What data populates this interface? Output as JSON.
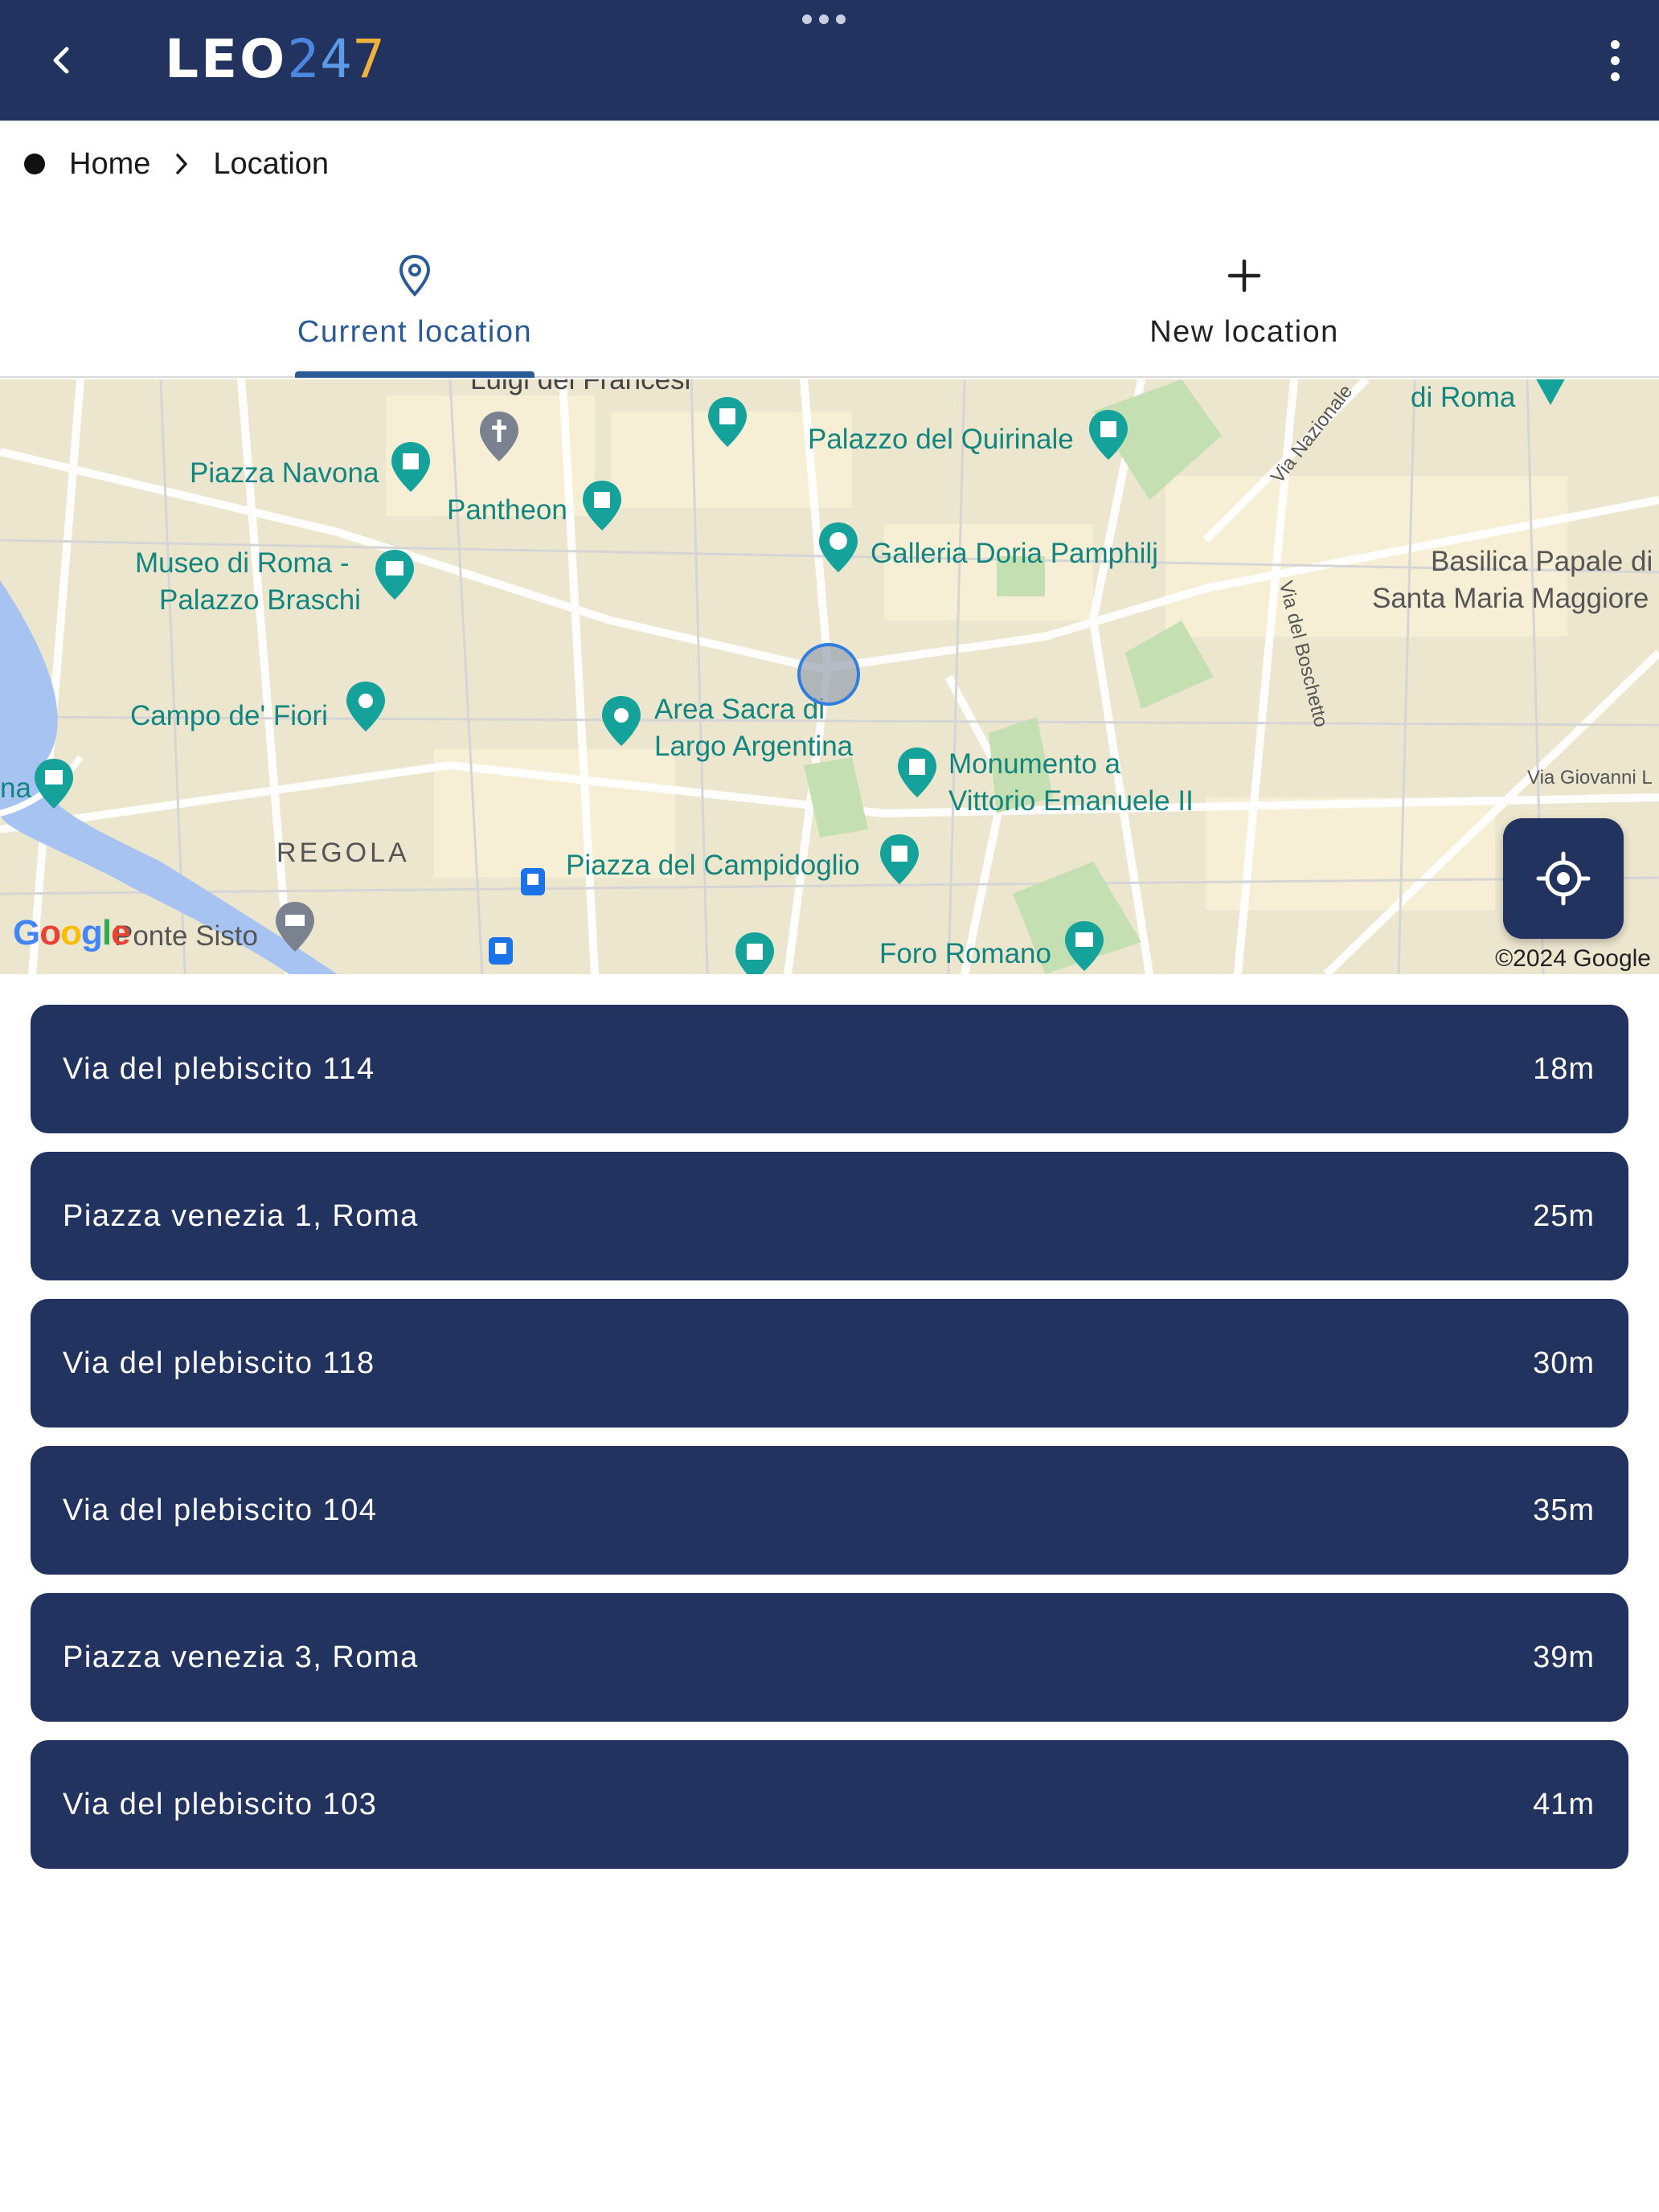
{
  "header": {
    "logo_main": "LEO",
    "logo_d1": "2",
    "logo_d2": "4",
    "logo_d3": "7",
    "bg_color": "#233360"
  },
  "breadcrumb": {
    "home": "Home",
    "current": "Location"
  },
  "tabs": [
    {
      "label": "Current location",
      "icon": "map-pin-icon",
      "active": true
    },
    {
      "label": "New location",
      "icon": "plus-icon",
      "active": false
    }
  ],
  "map": {
    "pois": [
      "Luigi dei Francesi",
      "Palazzo del Quirinale",
      "di Roma",
      "Piazza Navona",
      "Pantheon",
      "Galleria Doria Pamphilj",
      "Museo di Roma -",
      "Palazzo Braschi",
      "Basilica Papale di",
      "Santa Maria Maggiore",
      "Campo de' Fiori",
      "Area Sacra di",
      "Largo Argentina",
      "Monumento a",
      "Vittorio Emanuele II",
      "Piazza del Campidoglio",
      "Foro Romano",
      "Ponte Sisto",
      "na"
    ],
    "district": "REGOLA",
    "streets": [
      "Via Nazionale",
      "Via del Boschetto",
      "Via Giovanni L"
    ],
    "attribution_logo": "Google",
    "copyright": "©2024 Google"
  },
  "locations": [
    {
      "address": "Via del plebiscito 114",
      "distance": "18m"
    },
    {
      "address": "Piazza venezia 1, Roma",
      "distance": "25m"
    },
    {
      "address": "Via del plebiscito 118",
      "distance": "30m"
    },
    {
      "address": "Via del plebiscito 104",
      "distance": "35m"
    },
    {
      "address": "Piazza venezia 3, Roma",
      "distance": "39m"
    },
    {
      "address": "Via del plebiscito 103",
      "distance": "41m"
    }
  ],
  "colors": {
    "accent": "#2b5b96",
    "poi_text": "#12857e",
    "river": "#a7c3f2"
  }
}
